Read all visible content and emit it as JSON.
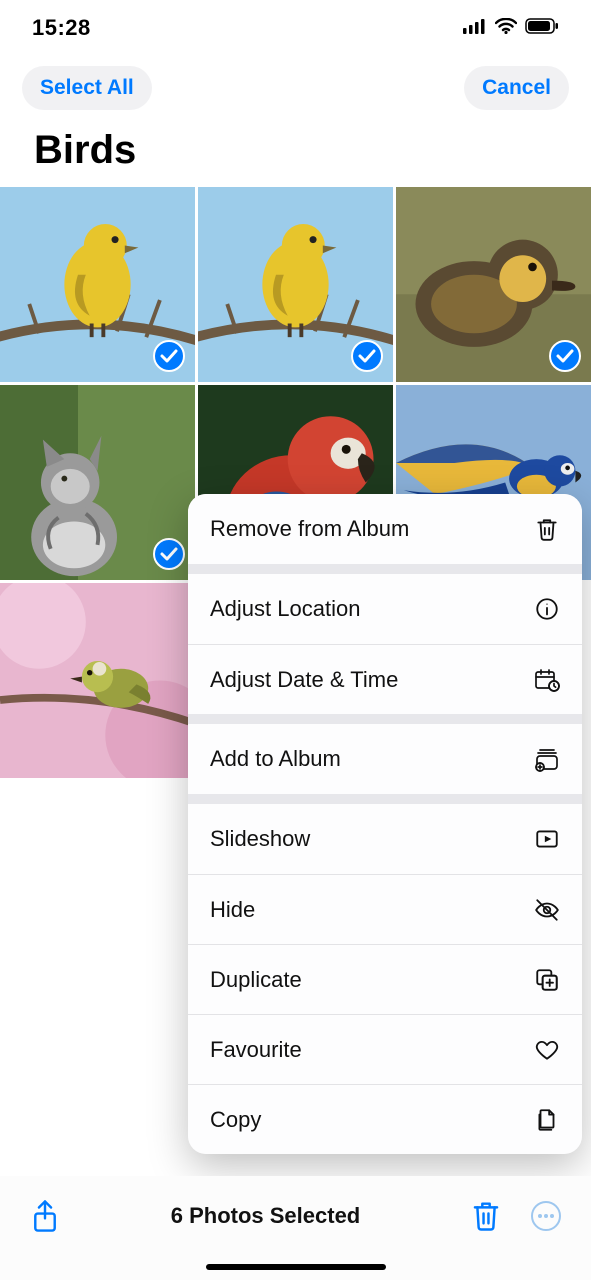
{
  "status": {
    "time": "15:28"
  },
  "nav": {
    "select_all": "Select All",
    "cancel": "Cancel"
  },
  "title": "Birds",
  "grid": {
    "items": [
      {
        "selected": true,
        "kind": "yellow-bird"
      },
      {
        "selected": true,
        "kind": "yellow-bird"
      },
      {
        "selected": true,
        "kind": "duckling"
      },
      {
        "selected": true,
        "kind": "kitten"
      },
      {
        "selected": false,
        "kind": "parrot-red"
      },
      {
        "selected": false,
        "kind": "macaw-flying"
      },
      {
        "selected": false,
        "kind": "warbler-blossom"
      }
    ]
  },
  "sheet": {
    "groups": [
      [
        {
          "label": "Remove from Album",
          "icon": "trash-icon"
        }
      ],
      [
        {
          "label": "Adjust Location",
          "icon": "info-icon"
        },
        {
          "label": "Adjust Date & Time",
          "icon": "calendar-clock-icon"
        }
      ],
      [
        {
          "label": "Add to Album",
          "icon": "album-add-icon"
        }
      ],
      [
        {
          "label": "Slideshow",
          "icon": "play-rect-icon"
        },
        {
          "label": "Hide",
          "icon": "eye-slash-icon"
        },
        {
          "label": "Duplicate",
          "icon": "duplicate-icon"
        },
        {
          "label": "Favourite",
          "icon": "heart-icon"
        },
        {
          "label": "Copy",
          "icon": "copy-doc-icon"
        }
      ]
    ]
  },
  "bottom": {
    "selected_text": "6 Photos Selected"
  },
  "colors": {
    "tint": "#007aff"
  }
}
